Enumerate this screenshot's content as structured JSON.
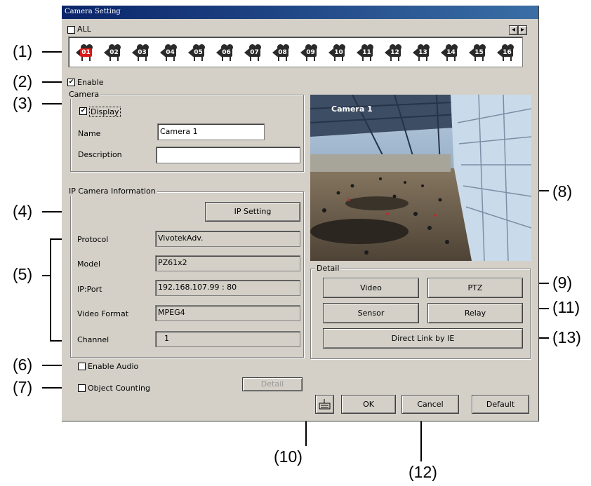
{
  "window": {
    "title": "Camera Setting"
  },
  "callouts": [
    "(1)",
    "(2)",
    "(3)",
    "(4)",
    "(5)",
    "(6)",
    "(7)",
    "(8)",
    "(9)",
    "(10)",
    "(11)",
    "(12)",
    "(13)"
  ],
  "top": {
    "all_label": "ALL",
    "all_checked": false,
    "scroll_left": "◂",
    "scroll_right": "▸"
  },
  "cameras": [
    "01",
    "02",
    "03",
    "04",
    "05",
    "06",
    "07",
    "08",
    "09",
    "10",
    "11",
    "12",
    "13",
    "14",
    "15",
    "16"
  ],
  "selected_camera": "01",
  "enable": {
    "label": "Enable",
    "checked": true
  },
  "camera_group": {
    "title": "Camera",
    "display_label": "Display",
    "display_checked": true,
    "name_label": "Name",
    "name_value": "Camera 1",
    "description_label": "Description",
    "description_value": ""
  },
  "ip_group": {
    "title": "IP Camera Information",
    "ip_setting_button": "IP Setting",
    "protocol_label": "Protocol",
    "protocol_value": "VivotekAdv.",
    "model_label": "Model",
    "model_value": "PZ61x2",
    "ipport_label": "IP:Port",
    "ipport_value": "192.168.107.99 : 80",
    "videoformat_label": "Video Format",
    "videoformat_value": "MPEG4",
    "channel_label": "Channel",
    "channel_value": "1"
  },
  "audio": {
    "label": "Enable Audio",
    "checked": false
  },
  "counting": {
    "label": "Object Counting",
    "checked": false,
    "detail_button": "Detail"
  },
  "preview": {
    "overlay_text": "Camera 1"
  },
  "detail_group": {
    "title": "Detail",
    "video_button": "Video",
    "ptz_button": "PTZ",
    "sensor_button": "Sensor",
    "relay_button": "Relay",
    "direct_link_button": "Direct Link by IE"
  },
  "footer": {
    "ok_button": "OK",
    "cancel_button": "Cancel",
    "default_button": "Default",
    "keyboard_icon": "keyboard-icon"
  },
  "colors": {
    "titlebar": "#0a246a",
    "dialog": "#d4d0c8",
    "selected_camera": "#d81818"
  }
}
